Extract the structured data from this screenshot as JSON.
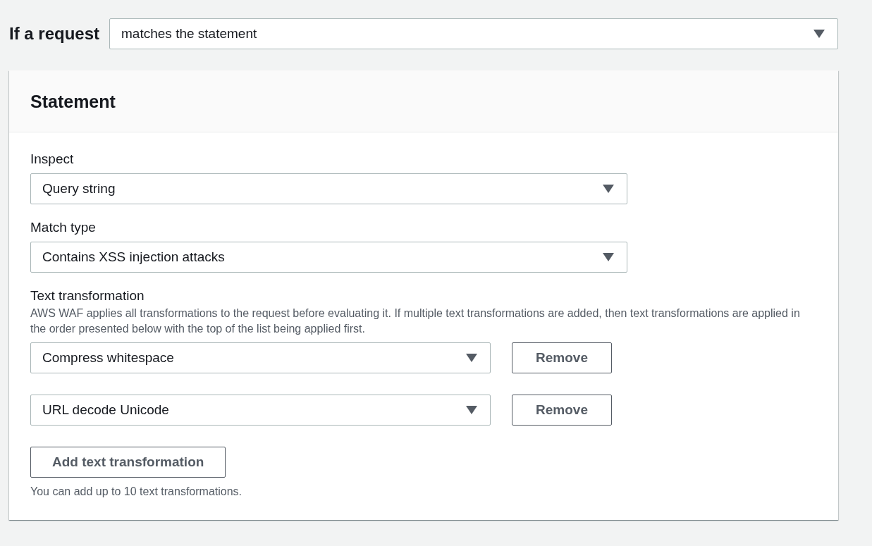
{
  "condition": {
    "label": "If a request",
    "value": "matches the statement"
  },
  "statement": {
    "title": "Statement",
    "fields": [
      {
        "label": "Inspect",
        "value": "Query string"
      },
      {
        "label": "Match type",
        "value": "Contains XSS injection attacks"
      }
    ],
    "text_transformation": {
      "label": "Text transformation",
      "description": "AWS WAF applies all transformations to the request before evaluating it. If multiple text transformations are added, then text transformations are applied in the order presented below with the top of the list being applied first.",
      "transformations": [
        {
          "value": "Compress whitespace",
          "remove_label": "Remove"
        },
        {
          "value": "URL decode Unicode",
          "remove_label": "Remove"
        }
      ],
      "add_button": "Add text transformation",
      "hint": "You can add up to 10 text transformations."
    }
  }
}
